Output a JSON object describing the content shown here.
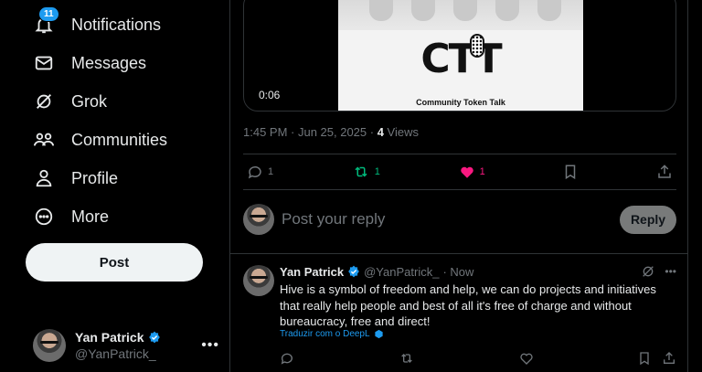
{
  "sidebar": {
    "items": [
      {
        "label": "Notifications",
        "icon": "bell-icon",
        "badge": "11"
      },
      {
        "label": "Messages",
        "icon": "envelope-icon"
      },
      {
        "label": "Grok",
        "icon": "grok-icon"
      },
      {
        "label": "Communities",
        "icon": "communities-icon"
      },
      {
        "label": "Profile",
        "icon": "person-icon"
      },
      {
        "label": "More",
        "icon": "more-circle-icon"
      }
    ],
    "post_label": "Post",
    "account": {
      "name": "Yan Patrick",
      "handle": "@YanPatrick_"
    }
  },
  "tweet": {
    "media": {
      "duration": "0:06",
      "logo_text": "CTT",
      "logo_subtitle": "Community Token Talk"
    },
    "meta": {
      "timestamp": "1:45 PM · Jun 25, 2025 · ",
      "views_count": "4",
      "views_label": " Views"
    },
    "actions": {
      "replies": "1",
      "reposts": "1",
      "likes": "1"
    }
  },
  "reply_box": {
    "placeholder": "Post your reply",
    "button_label": "Reply"
  },
  "reply_post": {
    "name": "Yan Patrick",
    "handle": "@YanPatrick_",
    "time": "· Now",
    "text": "Hive is a symbol of freedom and help, we can do projects and initiatives that really help people and best of all it's free of charge and without bureaucracy, free and direct!",
    "translate_label": "Traduzir com o DeepL"
  },
  "colors": {
    "accent": "#1d9bf0",
    "repost": "#00ba7c",
    "like": "#f91880",
    "background": "#000000"
  }
}
